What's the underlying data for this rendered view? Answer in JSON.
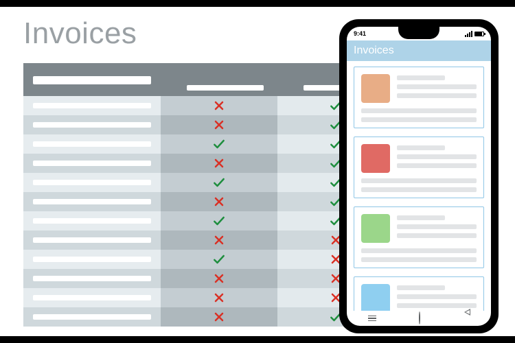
{
  "page": {
    "title": "Invoices"
  },
  "table": {
    "columns": 4,
    "rows": [
      {
        "c1": "cross",
        "c2": "check",
        "c3": null
      },
      {
        "c1": "cross",
        "c2": "check",
        "c3": null
      },
      {
        "c1": "check",
        "c2": "check",
        "c3": null
      },
      {
        "c1": "cross",
        "c2": "check",
        "c3": null
      },
      {
        "c1": "check",
        "c2": "check",
        "c3": null
      },
      {
        "c1": "cross",
        "c2": "check",
        "c3": null
      },
      {
        "c1": "check",
        "c2": "check",
        "c3": null
      },
      {
        "c1": "cross",
        "c2": "cross",
        "c3": null
      },
      {
        "c1": "check",
        "c2": "cross",
        "c3": null
      },
      {
        "c1": "cross",
        "c2": "cross",
        "c3": null
      },
      {
        "c1": "cross",
        "c2": "cross",
        "c3": null
      },
      {
        "c1": "cross",
        "c2": "check",
        "c3": null
      }
    ]
  },
  "phone": {
    "status": {
      "time": "9:41"
    },
    "app_title": "Invoices",
    "cards": [
      {
        "color": "#e8ad86"
      },
      {
        "color": "#e06a64"
      },
      {
        "color": "#9bd68a"
      },
      {
        "color": "#8fcff0"
      }
    ]
  },
  "colors": {
    "check": "#1e8e3e",
    "cross": "#d93025"
  }
}
